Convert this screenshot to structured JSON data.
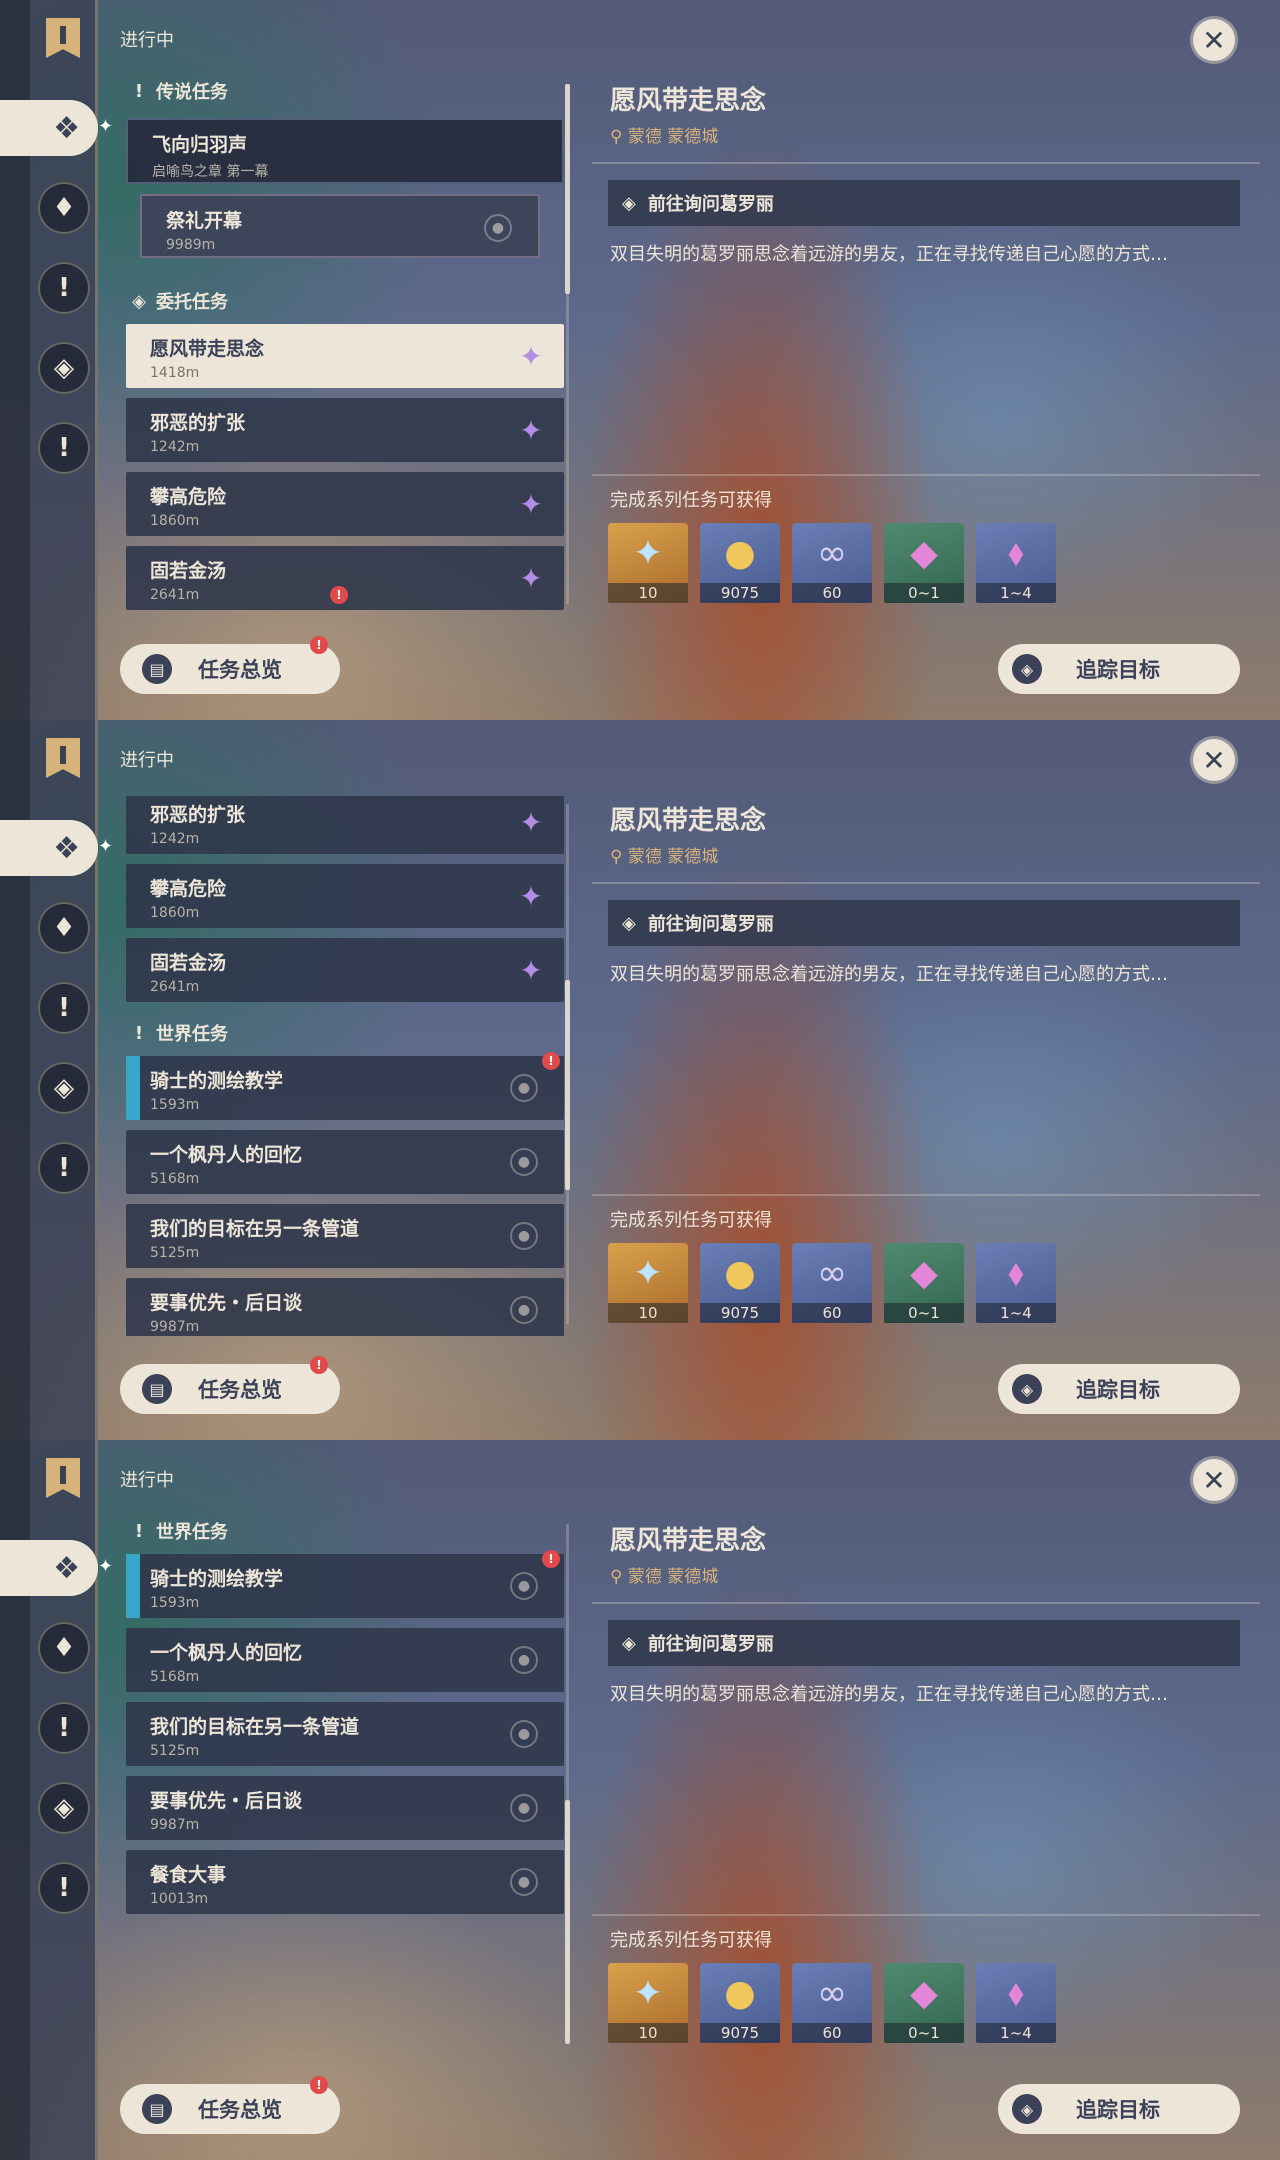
{
  "header": {
    "status": "进行中"
  },
  "icons": {
    "close": "close-icon",
    "marker": "commission-marker-icon",
    "pin": "map-pin-icon",
    "legend": "legend-quest-icon",
    "world": "world-quest-icon",
    "commission": "commission-icon"
  },
  "colors": {
    "accent": "#ece5d8",
    "panel": "#30374b",
    "gold": "#d6b37a",
    "alert": "#e04a4a",
    "world_stripe": "#38a6c9"
  },
  "groups": {
    "legend": "传说任务",
    "commission": "委托任务",
    "world": "世界任务"
  },
  "quests": {
    "legend_main": {
      "title": "飞向归羽声",
      "detail": "启喻鸟之章 第一幕"
    },
    "legend_sub": {
      "title": "祭礼开幕",
      "distance": "9989m"
    },
    "c1": {
      "title": "愿风带走思念",
      "distance": "1418m"
    },
    "c2": {
      "title": "邪恶的扩张",
      "distance": "1242m"
    },
    "c3": {
      "title": "攀高危险",
      "distance": "1860m"
    },
    "c4": {
      "title": "固若金汤",
      "distance": "2641m"
    },
    "w1": {
      "title": "骑士的测绘教学",
      "distance": "1593m"
    },
    "w2": {
      "title": "一个枫丹人的回忆",
      "distance": "5168m"
    },
    "w3": {
      "title": "我们的目标在另一条管道",
      "distance": "5125m"
    },
    "w4": {
      "title": "要事优先・后日谈",
      "distance": "9987m"
    },
    "w5": {
      "title": "餐食大事",
      "distance": "10013m"
    }
  },
  "detail": {
    "title": "愿风带走思念",
    "location": "蒙德 蒙德城",
    "step": "前往询问葛罗丽",
    "description": "双目失明的葛罗丽思念着远游的男友，正在寻找传递自己心愿的方式…",
    "reward_label": "完成系列任务可获得",
    "rewards": [
      {
        "icon": "primogem-icon",
        "count": "10"
      },
      {
        "icon": "mora-icon",
        "count": "9075"
      },
      {
        "icon": "adventure-exp-icon",
        "count": "60"
      },
      {
        "icon": "crystal-chunk-icon",
        "count": "0~1"
      },
      {
        "icon": "crystal-cluster-icon",
        "count": "1~4"
      }
    ]
  },
  "buttons": {
    "overview": "任务总览",
    "track": "追踪目标"
  }
}
